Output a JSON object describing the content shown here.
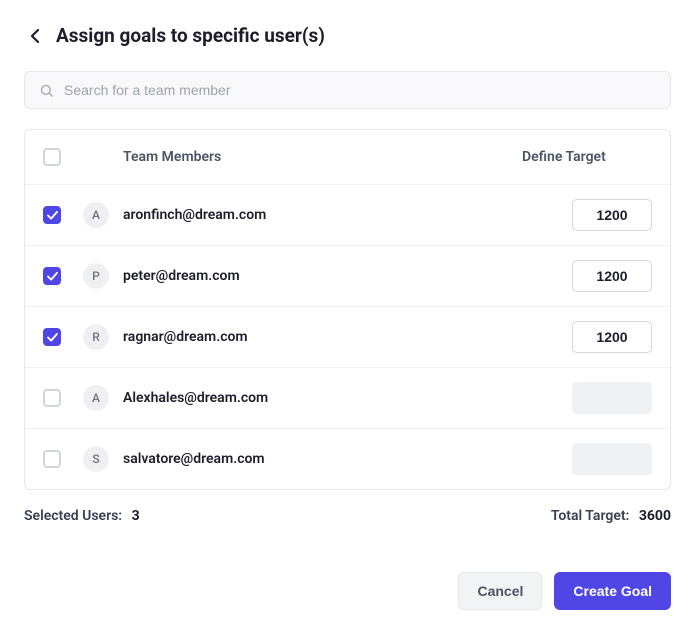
{
  "header": {
    "title": "Assign goals to specific user(s)"
  },
  "search": {
    "placeholder": "Search for a team member"
  },
  "columns": {
    "members": "Team Members",
    "target": "Define Target"
  },
  "rows": [
    {
      "checked": true,
      "initial": "A",
      "email": "aronfinch@dream.com",
      "target": "1200"
    },
    {
      "checked": true,
      "initial": "P",
      "email": "peter@dream.com",
      "target": "1200"
    },
    {
      "checked": true,
      "initial": "R",
      "email": "ragnar@dream.com",
      "target": "1200"
    },
    {
      "checked": false,
      "initial": "A",
      "email": "Alexhales@dream.com",
      "target": ""
    },
    {
      "checked": false,
      "initial": "S",
      "email": "salvatore@dream.com",
      "target": ""
    }
  ],
  "summary": {
    "selected_label": "Selected Users:",
    "selected_value": "3",
    "total_label": "Total Target:",
    "total_value": "3600"
  },
  "buttons": {
    "cancel": "Cancel",
    "create": "Create Goal"
  },
  "colors": {
    "primary": "#4f46e5"
  }
}
